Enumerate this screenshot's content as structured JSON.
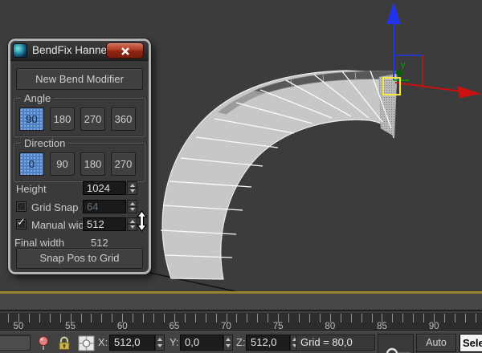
{
  "dialog": {
    "title": "BendFix Hannes",
    "new_bend_button": "New Bend Modifier",
    "angle": {
      "label": "Angle",
      "options": [
        "90",
        "180",
        "270",
        "360"
      ],
      "selected": "90"
    },
    "direction": {
      "label": "Direction",
      "options": [
        "0",
        "90",
        "180",
        "270"
      ],
      "selected": "0"
    },
    "height": {
      "label": "Height",
      "value": "1024"
    },
    "grid_snap": {
      "label": "Grid Snap",
      "value": "64",
      "checked": false
    },
    "manual_width": {
      "label": "Manual width",
      "value": "512",
      "checked": true,
      "checkmark": "✓"
    },
    "final_width": {
      "label": "Final width",
      "value": "512"
    },
    "snap_button": "Snap Pos to Grid"
  },
  "viewport": {
    "axis_y_label": "y",
    "colors": {
      "background": "#3c3c3c",
      "mesh": "#c7c7c7",
      "axis_x": "#cc1111",
      "axis_y": "#00a000",
      "axis_z": "#2233ee",
      "selection_bracket": "#f5e642",
      "active_border": "#97822f"
    }
  },
  "timeline": {
    "first_tick_value": 49,
    "first_tick_x": 10,
    "tick_spacing": 12.93,
    "labels": [
      50,
      55,
      60,
      65,
      70,
      75,
      80,
      85,
      90
    ]
  },
  "status_bar": {
    "x_label": "X:",
    "x_value": "512,0",
    "y_label": "Y:",
    "y_value": "0,0",
    "z_label": "Z:",
    "z_value": "512,0",
    "grid_value": "Grid = 80,0",
    "auto_key_label": "Auto Key",
    "select_label": "Select"
  },
  "icons": {
    "titlebar": "max-logo-icon",
    "close": "close-x-icon",
    "pin": "pushpin-icon",
    "lock": "padlock-icon",
    "transform_mode": "absolute-mode-icon",
    "set_key": "key-icon"
  },
  "colors": {
    "accent_blue": "#4d80c4",
    "close_red": "#b03a24"
  }
}
